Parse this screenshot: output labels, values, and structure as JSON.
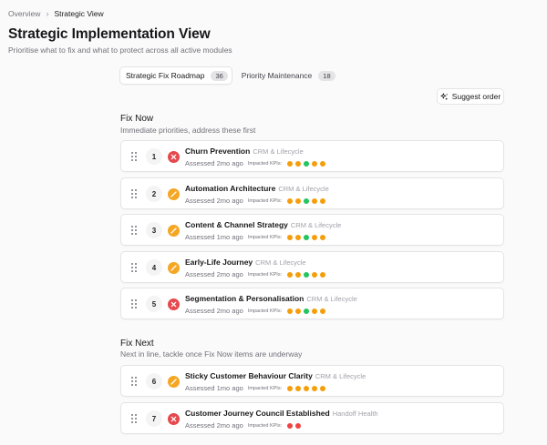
{
  "breadcrumb": {
    "parent": "Overview",
    "separator": "›",
    "current": "Strategic View"
  },
  "header": {
    "title": "Strategic Implementation View",
    "subtitle": "Prioritise what to fix and what to protect across all active modules"
  },
  "tabs": [
    {
      "label": "Strategic Fix Roadmap",
      "count": "36",
      "active": true
    },
    {
      "label": "Priority Maintenance",
      "count": "18",
      "active": false
    }
  ],
  "suggest_button": {
    "label": "Suggest order",
    "icon": "sparkles-icon"
  },
  "colors": {
    "red": "#ef4444",
    "amber": "#f59e0b",
    "green": "#22c55e",
    "status_fix": "#e5484d",
    "status_warn": "#f5a623"
  },
  "sections": [
    {
      "title": "Fix Now",
      "description": "Immediate priorities, address these first",
      "items": [
        {
          "rank": "1",
          "status": "critical",
          "name": "Churn Prevention",
          "category": "CRM & Lifecycle",
          "assessed": "Assessed 2mo ago",
          "kpi_label": "Impacted KPIs:",
          "kpis": [
            "amber",
            "amber",
            "green",
            "amber",
            "amber"
          ]
        },
        {
          "rank": "2",
          "status": "warning",
          "name": "Automation Architecture",
          "category": "CRM & Lifecycle",
          "assessed": "Assessed 2mo ago",
          "kpi_label": "Impacted KPIs:",
          "kpis": [
            "amber",
            "amber",
            "green",
            "amber",
            "amber"
          ]
        },
        {
          "rank": "3",
          "status": "warning",
          "name": "Content & Channel Strategy",
          "category": "CRM & Lifecycle",
          "assessed": "Assessed 1mo ago",
          "kpi_label": "Impacted KPIs:",
          "kpis": [
            "amber",
            "amber",
            "green",
            "amber",
            "amber"
          ]
        },
        {
          "rank": "4",
          "status": "warning",
          "name": "Early-Life Journey",
          "category": "CRM & Lifecycle",
          "assessed": "Assessed 2mo ago",
          "kpi_label": "Impacted KPIs:",
          "kpis": [
            "amber",
            "amber",
            "green",
            "amber",
            "amber"
          ]
        },
        {
          "rank": "5",
          "status": "critical",
          "name": "Segmentation & Personalisation",
          "category": "CRM & Lifecycle",
          "assessed": "Assessed 2mo ago",
          "kpi_label": "Impacted KPIs:",
          "kpis": [
            "amber",
            "amber",
            "green",
            "amber",
            "amber"
          ]
        }
      ]
    },
    {
      "title": "Fix Next",
      "description": "Next in line, tackle once Fix Now items are underway",
      "items": [
        {
          "rank": "6",
          "status": "warning",
          "name": "Sticky Customer Behaviour Clarity",
          "category": "CRM & Lifecycle",
          "assessed": "Assessed 1mo ago",
          "kpi_label": "Impacted KPIs:",
          "kpis": [
            "amber",
            "amber",
            "amber",
            "amber",
            "amber"
          ]
        },
        {
          "rank": "7",
          "status": "critical",
          "name": "Customer Journey Council Established",
          "category": "Handoff Health",
          "assessed": "Assessed 2mo ago",
          "kpi_label": "Impacted KPIs:",
          "kpis": [
            "red",
            "red"
          ]
        }
      ]
    }
  ]
}
